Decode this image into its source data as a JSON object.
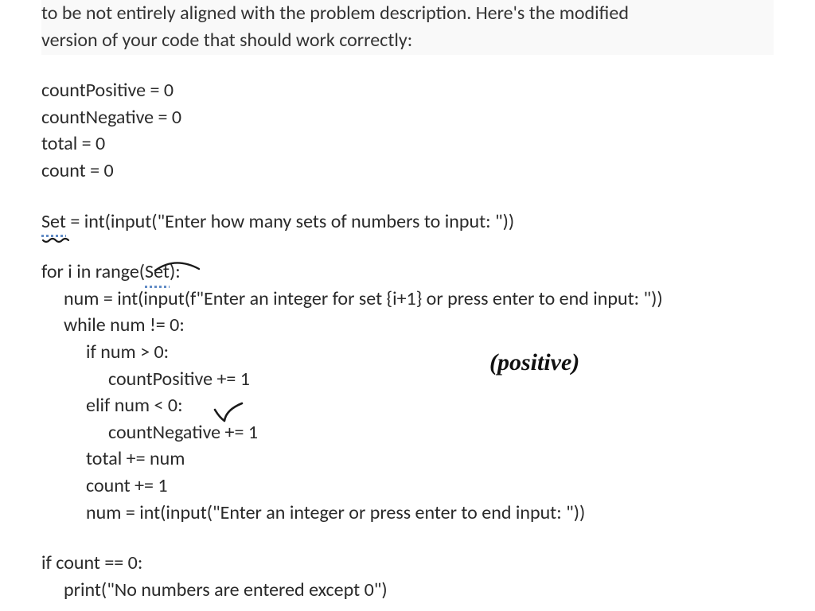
{
  "intro": {
    "line1": "to be not entirely aligned with the problem description. Here's the modified",
    "line2": "version of your code that should work correctly:"
  },
  "code": {
    "l01": "countPositive = 0",
    "l02": "countNegative = 0",
    "l03": "total = 0",
    "l04": "count = 0",
    "l05a": "Set",
    "l05b": " = int(input(\"Enter how many sets of numbers to input: \"))",
    "l06a": "for i in range(",
    "l06b": "Set",
    "l06c": "):",
    "l07": "num = int(input(f\"Enter an integer for set {i+1} or press enter to end input: \"))",
    "l08": "while num != 0:",
    "l09": "if num > 0:",
    "l10": "countPositive += 1",
    "l11": "elif num < 0:",
    "l12": "countNegative += 1",
    "l13": "total += num",
    "l14": "count += 1",
    "l15": "num = int(input(\"Enter an integer or press enter to end input: \"))",
    "l16": "if count == 0:",
    "l17": "print(\"No numbers are entered except 0\")"
  },
  "annotations": {
    "positive": "(positive)"
  }
}
